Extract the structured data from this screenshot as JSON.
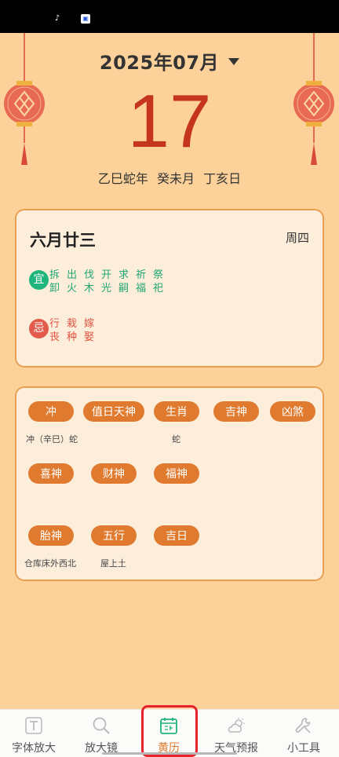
{
  "header": {
    "month_label": "2025年07月",
    "day_number": "17",
    "ganzhi": "乙巳蛇年  癸未月  丁亥日"
  },
  "lunar": {
    "date": "六月廿三",
    "weekday": "周四",
    "yi_label": "宜",
    "ji_label": "忌",
    "yi_row1": "拆出伐开求祈祭",
    "yi_row2": "卸火木光嗣福祀",
    "ji_row1": "行栽嫁",
    "ji_row2": "丧种娶"
  },
  "gods": {
    "row1": [
      "冲",
      "值日天神",
      "生肖",
      "吉神",
      "凶煞"
    ],
    "row1_note_chong": "冲（辛巳）蛇",
    "row1_note_shengxiao": "蛇",
    "row2": [
      "喜神",
      "财神",
      "福神"
    ],
    "row3": [
      "胎神",
      "五行",
      "吉日"
    ],
    "row3_note_taishen": "仓库床外西北",
    "row3_note_wuxing": "屋上土"
  },
  "tabs": [
    {
      "label": "字体放大",
      "icon": "font-size-icon"
    },
    {
      "label": "放大镜",
      "icon": "magnifier-icon"
    },
    {
      "label": "黄历",
      "icon": "calendar-icon"
    },
    {
      "label": "天气预报",
      "icon": "weather-icon"
    },
    {
      "label": "小工具",
      "icon": "wrench-icon"
    }
  ],
  "colors": {
    "background": "#fdd29a",
    "accent": "#e07a2e",
    "day_red": "#c5341f",
    "yi_green": "#1fb57c",
    "ji_red": "#e25b4b"
  }
}
